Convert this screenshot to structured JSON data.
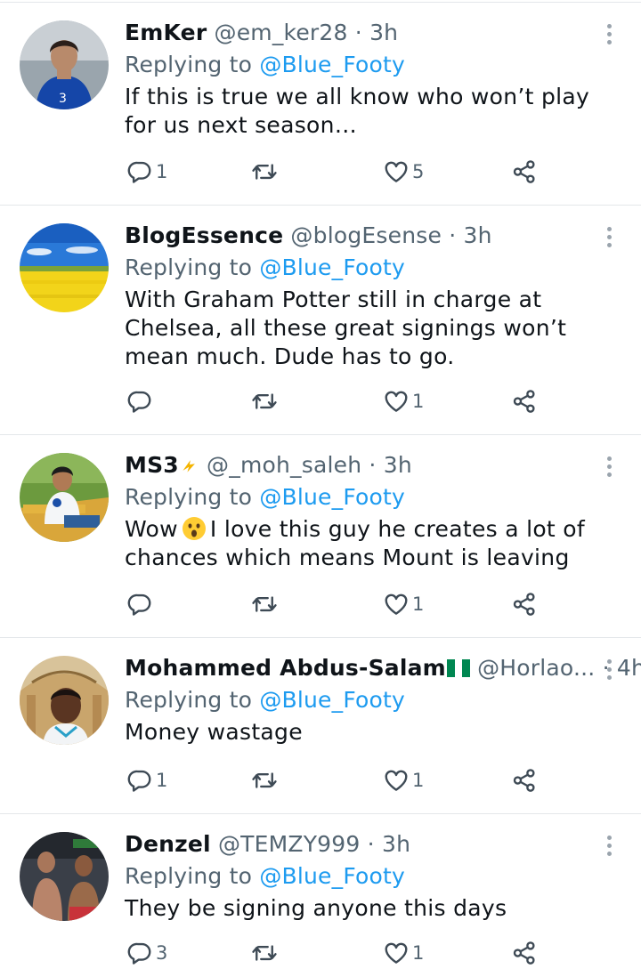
{
  "replying_label": "Replying to",
  "tweets": [
    {
      "name": "EmKer",
      "handle": "@em_ker28",
      "sep": "·",
      "time": "3h",
      "mention": "@Blue_Footy",
      "text": "If this is true we all know who won’t play for us next season…",
      "reply_count": "1",
      "retweet_count": "",
      "like_count": "5"
    },
    {
      "name": "BlogEssence",
      "handle": "@blogEsense",
      "sep": "·",
      "time": "3h",
      "mention": "@Blue_Footy",
      "text": "With Graham Potter still in charge at Chelsea, all these great signings won’t mean much. Dude has to go.",
      "reply_count": "",
      "retweet_count": "",
      "like_count": "1"
    },
    {
      "name": "MS3",
      "handle": "@_moh_saleh",
      "sep": "·",
      "time": "3h",
      "mention": "@Blue_Footy",
      "text_before": "Wow",
      "text_after": "I love this guy he creates a lot of chances which means Mount is leaving",
      "reply_count": "",
      "retweet_count": "",
      "like_count": "1"
    },
    {
      "name": "Mohammed Abdus-Salam",
      "handle": "@Horlao...",
      "sep": "·",
      "time": "4h",
      "mention": "@Blue_Footy",
      "text": "Money wastage",
      "reply_count": "1",
      "retweet_count": "",
      "like_count": "1"
    },
    {
      "name": "Denzel",
      "handle": "@TEMZY999",
      "sep": "·",
      "time": "3h",
      "mention": "@Blue_Footy",
      "text": "They be signing anyone this days",
      "reply_count": "3",
      "retweet_count": "",
      "like_count": "1"
    }
  ],
  "colors": {
    "link": "#1d9bf0",
    "muted": "#536471",
    "divider": "#e4e7ea"
  }
}
